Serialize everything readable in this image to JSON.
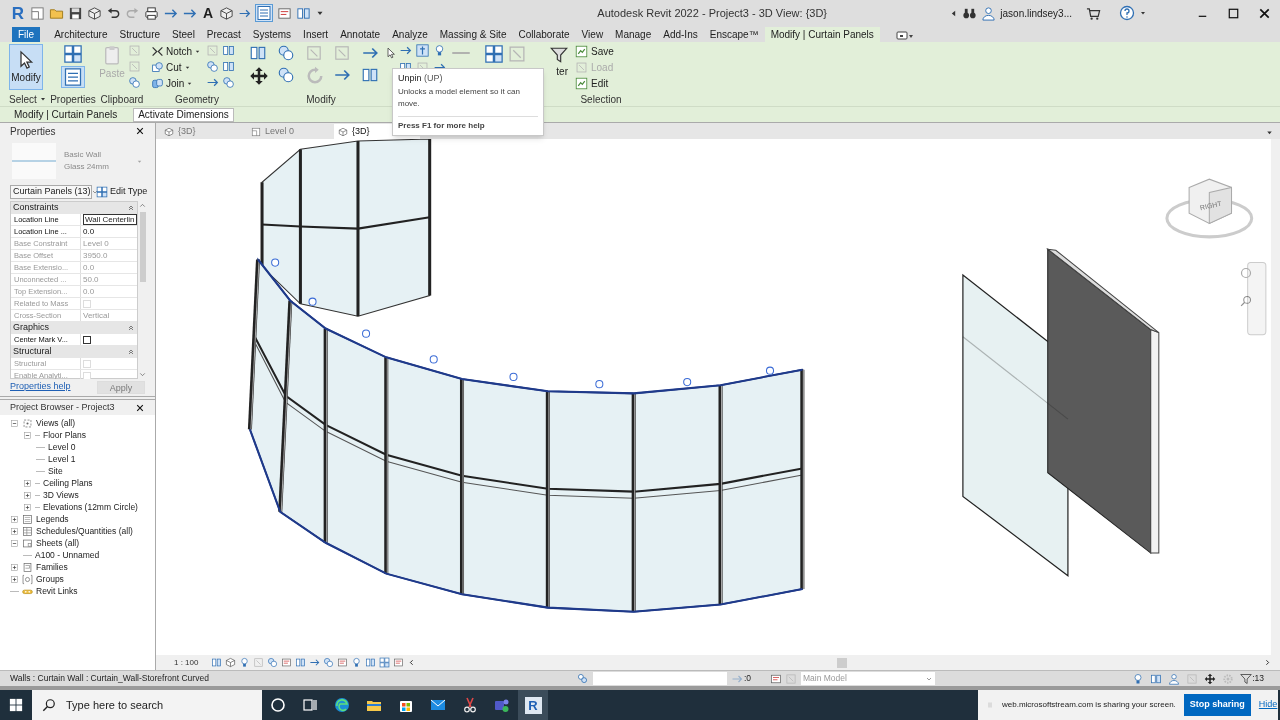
{
  "window": {
    "logo": "R",
    "text_tool": "A",
    "title": "Autodesk Revit 2022 - Project3 - 3D View: {3D}",
    "user": "jason.lindsey3..."
  },
  "ribbon_tabs": [
    {
      "label": "File",
      "kind": "file",
      "selected": false
    },
    {
      "label": "Architecture",
      "kind": "tab",
      "selected": false
    },
    {
      "label": "Structure",
      "kind": "tab",
      "selected": false
    },
    {
      "label": "Steel",
      "kind": "tab",
      "selected": false
    },
    {
      "label": "Precast",
      "kind": "tab",
      "selected": false
    },
    {
      "label": "Systems",
      "kind": "tab",
      "selected": false
    },
    {
      "label": "Insert",
      "kind": "tab",
      "selected": false
    },
    {
      "label": "Annotate",
      "kind": "tab",
      "selected": false
    },
    {
      "label": "Analyze",
      "kind": "tab",
      "selected": false
    },
    {
      "label": "Massing & Site",
      "kind": "tab",
      "selected": false
    },
    {
      "label": "Collaborate",
      "kind": "tab",
      "selected": false
    },
    {
      "label": "View",
      "kind": "tab",
      "selected": false
    },
    {
      "label": "Manage",
      "kind": "tab",
      "selected": false
    },
    {
      "label": "Add-Ins",
      "kind": "tab",
      "selected": false
    },
    {
      "label": "Enscape™",
      "kind": "tab",
      "selected": false
    },
    {
      "label": "Modify | Curtain Panels",
      "kind": "context",
      "selected": true
    }
  ],
  "ribbon": {
    "modify_button": {
      "label": "Modify",
      "selected": true
    },
    "paste_button": {
      "label": "Paste",
      "disabled": true
    },
    "geometry_tools": [
      {
        "label": "Notch"
      },
      {
        "label": "Cut"
      },
      {
        "label": "Join"
      }
    ],
    "filter_label": "ter",
    "selection_tools": [
      {
        "label": "Save",
        "disabled": false
      },
      {
        "label": "Load",
        "disabled": true
      },
      {
        "label": "Edit",
        "disabled": false
      }
    ],
    "panel_titles": [
      "Select",
      "Properties",
      "Clipboard",
      "Geometry",
      "Modify",
      "Selection"
    ]
  },
  "tooltip": {
    "title": "Unpin",
    "shortcut": "(UP)",
    "description": "Unlocks a model element so it can move.",
    "help": "Press F1 for more help"
  },
  "options_bar": {
    "context": "Modify | Curtain Panels",
    "button": "Activate Dimensions"
  },
  "properties": {
    "title": "Properties",
    "type_name": "Basic Wall",
    "type_detail": "Glass 24mm",
    "selector": "Curtain Panels (13)",
    "edit_type": "Edit Type",
    "groups": [
      {
        "title": "Constraints",
        "rows": [
          {
            "label": "Location Line",
            "kind": "field",
            "value": "Wall Centerlin",
            "disabled": false
          },
          {
            "label": "Location Line ...",
            "kind": "text",
            "value": "0.0",
            "disabled": false
          },
          {
            "label": "Base Constraint",
            "kind": "text",
            "value": "Level 0",
            "disabled": true
          },
          {
            "label": "Base Offset",
            "kind": "text",
            "value": "3950.0",
            "disabled": true
          },
          {
            "label": "Base Extensio...",
            "kind": "text",
            "value": "0.0",
            "disabled": true
          },
          {
            "label": "Unconnected ...",
            "kind": "text",
            "value": "50.0",
            "disabled": true
          },
          {
            "label": "Top Extension...",
            "kind": "text",
            "value": "0.0",
            "disabled": true
          },
          {
            "label": "Related to Mass",
            "kind": "check",
            "checked": false,
            "disabled": true
          },
          {
            "label": "Cross-Section",
            "kind": "text",
            "value": "Vertical",
            "disabled": true
          }
        ]
      },
      {
        "title": "Graphics",
        "rows": [
          {
            "label": "Center Mark V...",
            "kind": "check",
            "checked": false,
            "disabled": false
          }
        ]
      },
      {
        "title": "Structural",
        "rows": [
          {
            "label": "Structural",
            "kind": "check",
            "checked": false,
            "disabled": true
          },
          {
            "label": "Enable Analyti...",
            "kind": "check",
            "checked": false,
            "disabled": true
          }
        ]
      }
    ],
    "help_link": "Properties help",
    "apply": "Apply"
  },
  "project_browser": {
    "title": "Project Browser - Project3",
    "tree": [
      {
        "label": "Views (all)",
        "kind": "views",
        "expanded": true,
        "children": [
          {
            "label": "Floor Plans",
            "kind": "folder",
            "expanded": true,
            "children": [
              {
                "label": "Level 0",
                "kind": "leaf"
              },
              {
                "label": "Level 1",
                "kind": "leaf"
              },
              {
                "label": "Site",
                "kind": "leaf"
              }
            ]
          },
          {
            "label": "Ceiling Plans",
            "kind": "folder",
            "expanded": false
          },
          {
            "label": "3D Views",
            "kind": "folder",
            "expanded": false
          },
          {
            "label": "Elevations (12mm Circle)",
            "kind": "folder",
            "expanded": false
          }
        ]
      },
      {
        "label": "Legends",
        "kind": "legends",
        "expanded": false
      },
      {
        "label": "Schedules/Quantities (all)",
        "kind": "schedules",
        "expanded": false
      },
      {
        "label": "Sheets (all)",
        "kind": "sheets",
        "expanded": true,
        "children": [
          {
            "label": "A100 - Unnamed",
            "kind": "leaf"
          }
        ]
      },
      {
        "label": "Families",
        "kind": "families",
        "expanded": false
      },
      {
        "label": "Groups",
        "kind": "groups",
        "expanded": false
      },
      {
        "label": "Revit Links",
        "kind": "links"
      }
    ]
  },
  "view_tabs": [
    {
      "label": "{3D}",
      "selected": false
    },
    {
      "label": "Level 0",
      "selected": false
    },
    {
      "label": "{3D}",
      "selected": true
    }
  ],
  "viewcube": {
    "face": "RIGHT"
  },
  "view_control_bar": {
    "scale": "1 : 100"
  },
  "status_bar": {
    "text": "Walls : Curtain Wall : Curtain_Wall-Storefront Curved",
    "count": ":0",
    "model": "Main Model",
    "filter_count": ":13"
  },
  "taskbar": {
    "search_placeholder": "Type here to search",
    "revit_label": "R"
  },
  "share_bar": {
    "message": "web.microsoftstream.com is sharing your screen.",
    "stop": "Stop sharing",
    "hide": "Hide"
  }
}
